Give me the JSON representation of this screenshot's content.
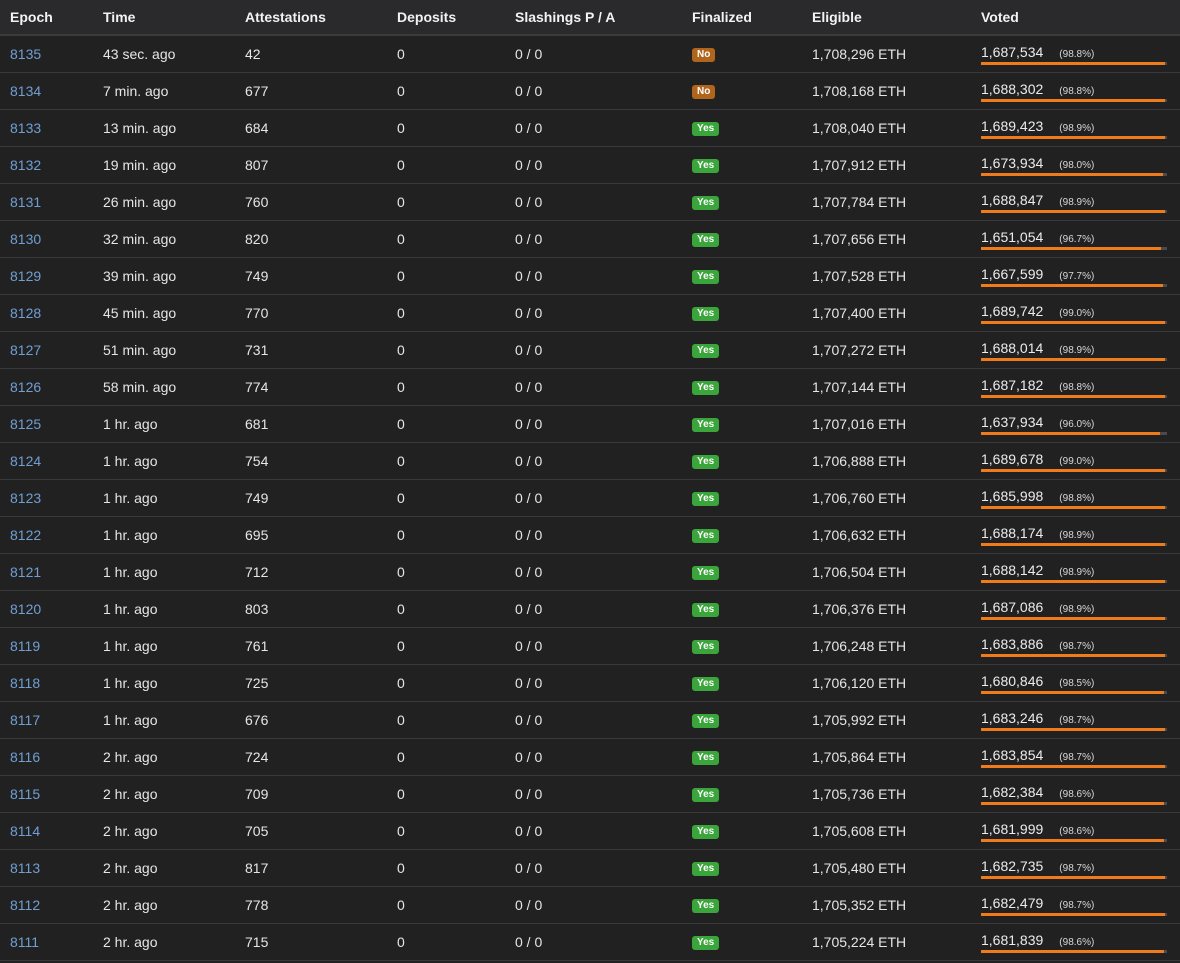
{
  "table": {
    "headers": [
      "Epoch",
      "Time",
      "Attestations",
      "Deposits",
      "Slashings P / A",
      "Finalized",
      "Eligible",
      "Voted"
    ],
    "rows": [
      {
        "epoch": "8135",
        "time": "43 sec. ago",
        "attestations": "42",
        "deposits": "0",
        "slashings": "0 / 0",
        "finalized": "No",
        "eligible": "1,708,296 ETH",
        "voted": "1,687,534",
        "voted_pct": "(98.8%)",
        "voted_frac": 0.988
      },
      {
        "epoch": "8134",
        "time": "7 min. ago",
        "attestations": "677",
        "deposits": "0",
        "slashings": "0 / 0",
        "finalized": "No",
        "eligible": "1,708,168 ETH",
        "voted": "1,688,302",
        "voted_pct": "(98.8%)",
        "voted_frac": 0.988
      },
      {
        "epoch": "8133",
        "time": "13 min. ago",
        "attestations": "684",
        "deposits": "0",
        "slashings": "0 / 0",
        "finalized": "Yes",
        "eligible": "1,708,040 ETH",
        "voted": "1,689,423",
        "voted_pct": "(98.9%)",
        "voted_frac": 0.989
      },
      {
        "epoch": "8132",
        "time": "19 min. ago",
        "attestations": "807",
        "deposits": "0",
        "slashings": "0 / 0",
        "finalized": "Yes",
        "eligible": "1,707,912 ETH",
        "voted": "1,673,934",
        "voted_pct": "(98.0%)",
        "voted_frac": 0.98
      },
      {
        "epoch": "8131",
        "time": "26 min. ago",
        "attestations": "760",
        "deposits": "0",
        "slashings": "0 / 0",
        "finalized": "Yes",
        "eligible": "1,707,784 ETH",
        "voted": "1,688,847",
        "voted_pct": "(98.9%)",
        "voted_frac": 0.989
      },
      {
        "epoch": "8130",
        "time": "32 min. ago",
        "attestations": "820",
        "deposits": "0",
        "slashings": "0 / 0",
        "finalized": "Yes",
        "eligible": "1,707,656 ETH",
        "voted": "1,651,054",
        "voted_pct": "(96.7%)",
        "voted_frac": 0.967
      },
      {
        "epoch": "8129",
        "time": "39 min. ago",
        "attestations": "749",
        "deposits": "0",
        "slashings": "0 / 0",
        "finalized": "Yes",
        "eligible": "1,707,528 ETH",
        "voted": "1,667,599",
        "voted_pct": "(97.7%)",
        "voted_frac": 0.977
      },
      {
        "epoch": "8128",
        "time": "45 min. ago",
        "attestations": "770",
        "deposits": "0",
        "slashings": "0 / 0",
        "finalized": "Yes",
        "eligible": "1,707,400 ETH",
        "voted": "1,689,742",
        "voted_pct": "(99.0%)",
        "voted_frac": 0.99
      },
      {
        "epoch": "8127",
        "time": "51 min. ago",
        "attestations": "731",
        "deposits": "0",
        "slashings": "0 / 0",
        "finalized": "Yes",
        "eligible": "1,707,272 ETH",
        "voted": "1,688,014",
        "voted_pct": "(98.9%)",
        "voted_frac": 0.989
      },
      {
        "epoch": "8126",
        "time": "58 min. ago",
        "attestations": "774",
        "deposits": "0",
        "slashings": "0 / 0",
        "finalized": "Yes",
        "eligible": "1,707,144 ETH",
        "voted": "1,687,182",
        "voted_pct": "(98.8%)",
        "voted_frac": 0.988
      },
      {
        "epoch": "8125",
        "time": "1 hr. ago",
        "attestations": "681",
        "deposits": "0",
        "slashings": "0 / 0",
        "finalized": "Yes",
        "eligible": "1,707,016 ETH",
        "voted": "1,637,934",
        "voted_pct": "(96.0%)",
        "voted_frac": 0.96
      },
      {
        "epoch": "8124",
        "time": "1 hr. ago",
        "attestations": "754",
        "deposits": "0",
        "slashings": "0 / 0",
        "finalized": "Yes",
        "eligible": "1,706,888 ETH",
        "voted": "1,689,678",
        "voted_pct": "(99.0%)",
        "voted_frac": 0.99
      },
      {
        "epoch": "8123",
        "time": "1 hr. ago",
        "attestations": "749",
        "deposits": "0",
        "slashings": "0 / 0",
        "finalized": "Yes",
        "eligible": "1,706,760 ETH",
        "voted": "1,685,998",
        "voted_pct": "(98.8%)",
        "voted_frac": 0.988
      },
      {
        "epoch": "8122",
        "time": "1 hr. ago",
        "attestations": "695",
        "deposits": "0",
        "slashings": "0 / 0",
        "finalized": "Yes",
        "eligible": "1,706,632 ETH",
        "voted": "1,688,174",
        "voted_pct": "(98.9%)",
        "voted_frac": 0.989
      },
      {
        "epoch": "8121",
        "time": "1 hr. ago",
        "attestations": "712",
        "deposits": "0",
        "slashings": "0 / 0",
        "finalized": "Yes",
        "eligible": "1,706,504 ETH",
        "voted": "1,688,142",
        "voted_pct": "(98.9%)",
        "voted_frac": 0.989
      },
      {
        "epoch": "8120",
        "time": "1 hr. ago",
        "attestations": "803",
        "deposits": "0",
        "slashings": "0 / 0",
        "finalized": "Yes",
        "eligible": "1,706,376 ETH",
        "voted": "1,687,086",
        "voted_pct": "(98.9%)",
        "voted_frac": 0.989
      },
      {
        "epoch": "8119",
        "time": "1 hr. ago",
        "attestations": "761",
        "deposits": "0",
        "slashings": "0 / 0",
        "finalized": "Yes",
        "eligible": "1,706,248 ETH",
        "voted": "1,683,886",
        "voted_pct": "(98.7%)",
        "voted_frac": 0.987
      },
      {
        "epoch": "8118",
        "time": "1 hr. ago",
        "attestations": "725",
        "deposits": "0",
        "slashings": "0 / 0",
        "finalized": "Yes",
        "eligible": "1,706,120 ETH",
        "voted": "1,680,846",
        "voted_pct": "(98.5%)",
        "voted_frac": 0.985
      },
      {
        "epoch": "8117",
        "time": "1 hr. ago",
        "attestations": "676",
        "deposits": "0",
        "slashings": "0 / 0",
        "finalized": "Yes",
        "eligible": "1,705,992 ETH",
        "voted": "1,683,246",
        "voted_pct": "(98.7%)",
        "voted_frac": 0.987
      },
      {
        "epoch": "8116",
        "time": "2 hr. ago",
        "attestations": "724",
        "deposits": "0",
        "slashings": "0 / 0",
        "finalized": "Yes",
        "eligible": "1,705,864 ETH",
        "voted": "1,683,854",
        "voted_pct": "(98.7%)",
        "voted_frac": 0.987
      },
      {
        "epoch": "8115",
        "time": "2 hr. ago",
        "attestations": "709",
        "deposits": "0",
        "slashings": "0 / 0",
        "finalized": "Yes",
        "eligible": "1,705,736 ETH",
        "voted": "1,682,384",
        "voted_pct": "(98.6%)",
        "voted_frac": 0.986
      },
      {
        "epoch": "8114",
        "time": "2 hr. ago",
        "attestations": "705",
        "deposits": "0",
        "slashings": "0 / 0",
        "finalized": "Yes",
        "eligible": "1,705,608 ETH",
        "voted": "1,681,999",
        "voted_pct": "(98.6%)",
        "voted_frac": 0.986
      },
      {
        "epoch": "8113",
        "time": "2 hr. ago",
        "attestations": "817",
        "deposits": "0",
        "slashings": "0 / 0",
        "finalized": "Yes",
        "eligible": "1,705,480 ETH",
        "voted": "1,682,735",
        "voted_pct": "(98.7%)",
        "voted_frac": 0.987
      },
      {
        "epoch": "8112",
        "time": "2 hr. ago",
        "attestations": "778",
        "deposits": "0",
        "slashings": "0 / 0",
        "finalized": "Yes",
        "eligible": "1,705,352 ETH",
        "voted": "1,682,479",
        "voted_pct": "(98.7%)",
        "voted_frac": 0.987
      },
      {
        "epoch": "8111",
        "time": "2 hr. ago",
        "attestations": "715",
        "deposits": "0",
        "slashings": "0 / 0",
        "finalized": "Yes",
        "eligible": "1,705,224 ETH",
        "voted": "1,681,839",
        "voted_pct": "(98.6%)",
        "voted_frac": 0.986
      }
    ]
  },
  "colors": {
    "page_background": "#222122",
    "header_background": "#2a292b",
    "row_border": "#3a393b",
    "epoch_link": "#6f9fd3",
    "finalized_yes": "#3aa53a",
    "finalized_no": "#b0651c",
    "voted_bar": "#f07b1b",
    "voted_bar_track": "#4a494b"
  }
}
